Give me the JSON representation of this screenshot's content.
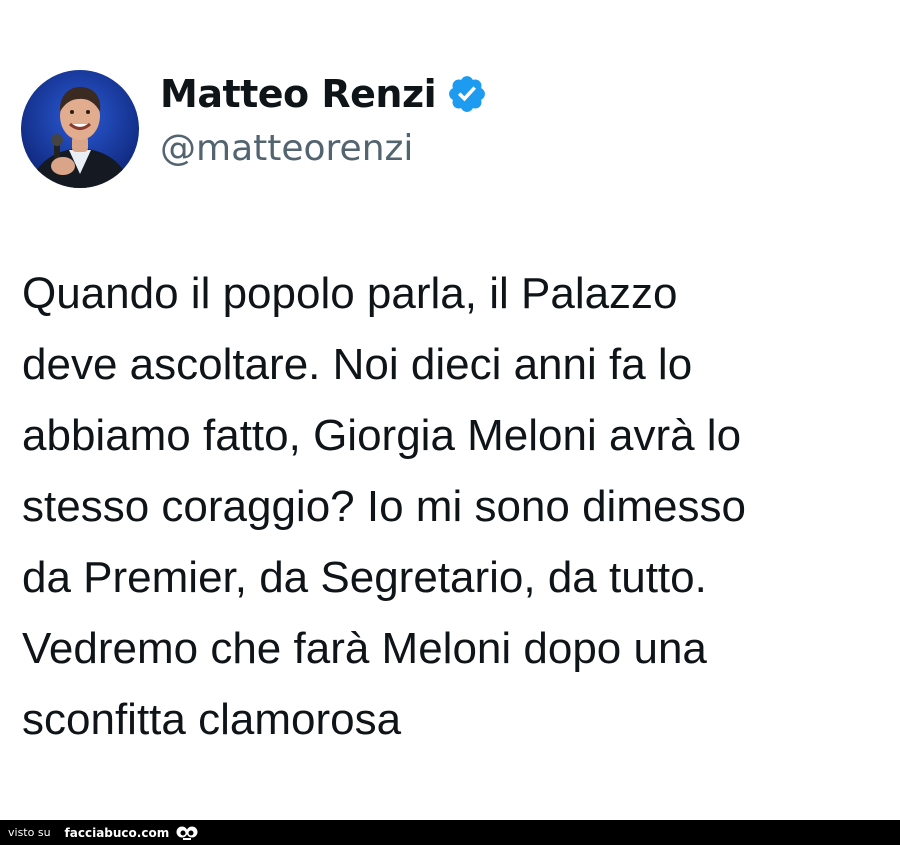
{
  "tweet": {
    "author": {
      "display_name": "Matteo Renzi",
      "handle": "@matteorenzi",
      "verified": true,
      "verified_badge_color": "#1d9bf0",
      "avatar_icon": "profile-photo"
    },
    "text_lines": [
      "Quando il popolo parla, il Palazzo",
      "deve ascoltare. Noi dieci anni fa lo",
      "abbiamo fatto, Giorgia Meloni avrà lo",
      "stesso coraggio? Io mi sono dimesso",
      "da Premier, da Segretario, da tutto.",
      "Vedremo che farà Meloni dopo una",
      "sconfitta clamorosa"
    ]
  },
  "footer": {
    "prefix": "visto su",
    "site": "facciabuco.com",
    "logo_icon": "eyes-icon"
  },
  "colors": {
    "text_primary": "#0f1419",
    "text_secondary": "#536471",
    "footer_background": "#000000"
  }
}
